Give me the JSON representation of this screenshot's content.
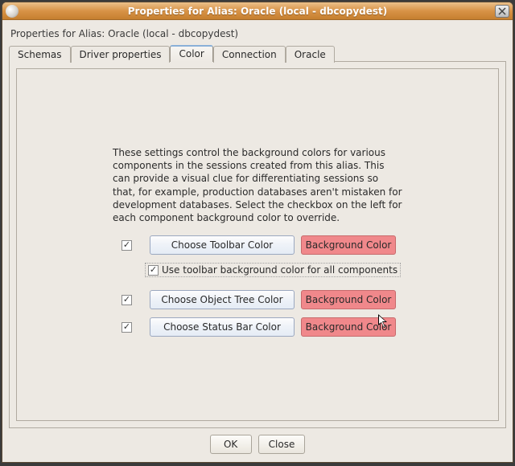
{
  "window": {
    "title": "Properties for Alias: Oracle (local - dbcopydest)"
  },
  "subtitle": "Properties for Alias: Oracle (local - dbcopydest)",
  "tabs": [
    {
      "label": "Schemas"
    },
    {
      "label": "Driver properties"
    },
    {
      "label": "Color"
    },
    {
      "label": "Connection"
    },
    {
      "label": "Oracle"
    }
  ],
  "active_tab_index": 2,
  "colorTab": {
    "description": "These settings control the background colors for various components in the sessions created from this alias.  This can provide a visual clue for differentiating sessions so that, for example, production databases aren't mistaken for development databases.  Select the checkbox on the left for each component background color to override.",
    "rows": [
      {
        "checked": true,
        "button_label": "Choose Toolbar Color",
        "swatch_label": "Background Color"
      },
      {
        "checked": true,
        "button_label": "Choose Object Tree Color",
        "swatch_label": "Background Color"
      },
      {
        "checked": true,
        "button_label": "Choose Status Bar Color",
        "swatch_label": "Background Color"
      }
    ],
    "useAll": {
      "checked": true,
      "label": "Use toolbar background color for all components"
    },
    "swatch_color": "#f0888b"
  },
  "footer": {
    "ok": "OK",
    "close": "Close"
  }
}
